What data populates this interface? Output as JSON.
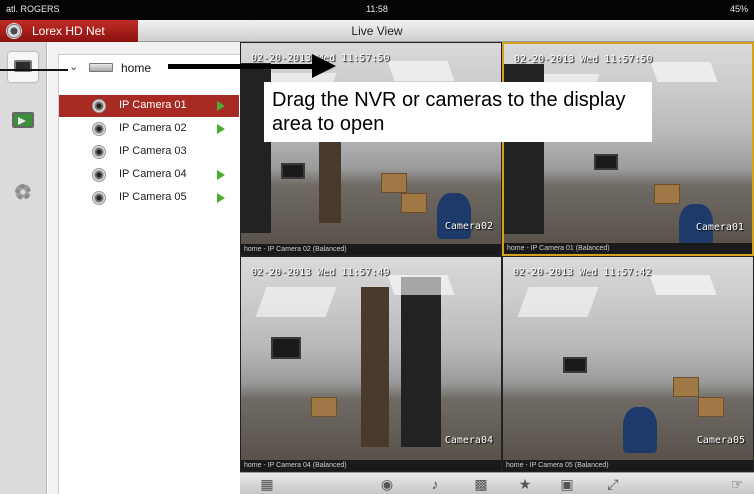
{
  "status_bar": {
    "carrier": "atl. ROGERS",
    "clock": "11:58",
    "battery": "45%"
  },
  "app": {
    "name": "Lorex HD Net",
    "view_title": "Live View"
  },
  "device_tree": {
    "root": "home",
    "cameras": [
      {
        "label": "IP Camera 01",
        "selected": true,
        "live": true
      },
      {
        "label": "IP Camera 02",
        "selected": false,
        "live": true
      },
      {
        "label": "IP Camera 03",
        "selected": false,
        "live": false
      },
      {
        "label": "IP Camera 04",
        "selected": false,
        "live": true
      },
      {
        "label": "IP Camera 05",
        "selected": false,
        "live": true
      }
    ]
  },
  "tiles": [
    {
      "timestamp": "02-20-2013 Wed 11:57:50",
      "overlay_name": "Camera02",
      "caption": "home - IP Camera 02 (Balanced)"
    },
    {
      "timestamp": "02-20-2013 Wed 11:57:50",
      "overlay_name": "Camera01",
      "caption": "home - IP Camera 01 (Balanced)"
    },
    {
      "timestamp": "02-20-2013 Wed 11:57:49",
      "overlay_name": "Camera04",
      "caption": "home - IP Camera 04 (Balanced)"
    },
    {
      "timestamp": "02-20-2013 Wed 11:57:42",
      "overlay_name": "Camera05",
      "caption": "home - IP Camera 05 (Balanced)"
    }
  ],
  "annotation": {
    "text": "Drag the NVR or cameras to the display area to open"
  },
  "colors": {
    "accent": "#a72a24",
    "live": "#4cae2e",
    "selected_tile": "#d2a21a"
  },
  "toolbar_icons": [
    "layout-icon",
    "snapshot-icon",
    "microphone-icon",
    "image-quality-icon",
    "favorite-icon",
    "close-all-icon",
    "fullscreen-icon",
    "ptz-icon"
  ]
}
